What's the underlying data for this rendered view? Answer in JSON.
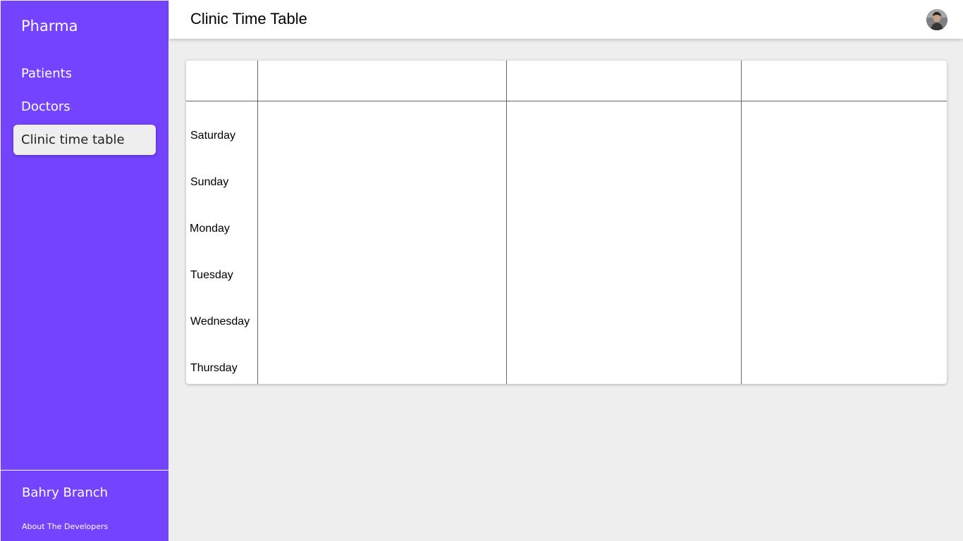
{
  "sidebar": {
    "brand": "Pharma",
    "items": [
      {
        "label": "Patients"
      },
      {
        "label": "Doctors"
      },
      {
        "label": "Clinic time table"
      }
    ],
    "branch": "Bahry Branch",
    "about": "About The Developers",
    "colors": {
      "background": "#7443ff",
      "active_item": "#eeeeee"
    }
  },
  "header": {
    "title": "Clinic Time Table",
    "avatar_icon": "user-avatar"
  },
  "timetable": {
    "columns": [
      "",
      "",
      "",
      ""
    ],
    "days": [
      "Saturday",
      "Sunday",
      "Monday",
      "Tuesday",
      "Wednesday",
      "Thursday"
    ]
  }
}
